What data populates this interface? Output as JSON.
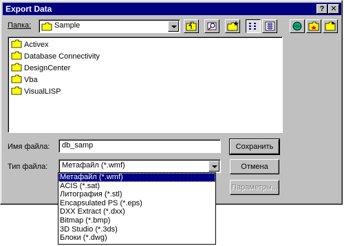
{
  "window": {
    "title": "Export Data",
    "help_label": "?",
    "close_label": "✕"
  },
  "lookin": {
    "label": "Папка:",
    "value": "Sample"
  },
  "toolbar": {
    "icons": [
      "up-folder-icon",
      "search-web-icon",
      "new-folder-icon",
      "list-view-icon",
      "details-view-icon"
    ],
    "right_icons": [
      "globe-icon",
      "favorites-folder-icon",
      "folder-icon"
    ]
  },
  "files": [
    {
      "name": "Activex"
    },
    {
      "name": "Database Connectivity"
    },
    {
      "name": "DesignCenter"
    },
    {
      "name": "Vba"
    },
    {
      "name": "VisualLISP"
    }
  ],
  "filename": {
    "label": "Имя файла:",
    "value": "db_samp"
  },
  "filetype": {
    "label": "Тип файла:",
    "value": "Метафайл (*.wmf)",
    "options": [
      "Метафайл (*.wmf)",
      "ACIS (*.sat)",
      "Литография (*.stl)",
      "Encapsulated PS (*.eps)",
      "DXX Extract (*.dxx)",
      "Bitmap (*.bmp)",
      "3D Studio (*.3ds)",
      "Блоки (*.dwg)"
    ],
    "selected_index": 0
  },
  "buttons": {
    "save": "Сохранить",
    "cancel": "Отмена",
    "options": "Параметры..."
  },
  "colors": {
    "titlebar": "#000080",
    "dialog": "#c0c0c0",
    "folder": "#ffff00",
    "selection": "#000080"
  }
}
